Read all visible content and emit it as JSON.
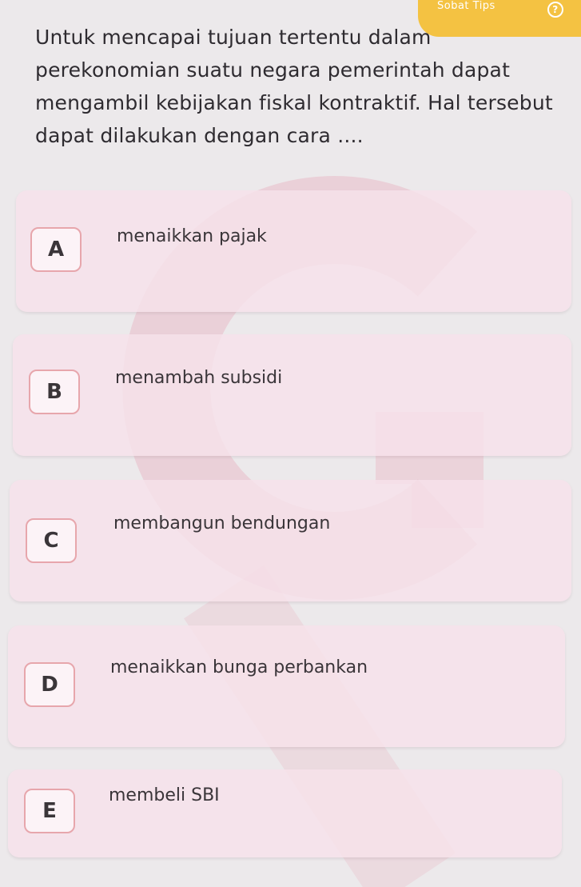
{
  "header": {
    "tips_label": "Sobat Tips",
    "help_glyph": "?"
  },
  "question": {
    "text": "Untuk mencapai tujuan tertentu dalam perekonomian suatu negara pemerintah dapat mengambil kebijakan fiskal kontraktif. Hal tersebut dapat dilakukan dengan cara ...."
  },
  "options": [
    {
      "letter": "A",
      "text": "menaikkan pajak"
    },
    {
      "letter": "B",
      "text": "menambah subsidi"
    },
    {
      "letter": "C",
      "text": "membangun bendungan"
    },
    {
      "letter": "D",
      "text": "menaikkan bunga perbankan"
    },
    {
      "letter": "E",
      "text": "membeli SBI"
    }
  ],
  "colors": {
    "tips_badge": "#f4c242",
    "option_background": "#f7e2ea",
    "letter_border": "#e7a6ac",
    "watermark": "#e9a3b4"
  }
}
